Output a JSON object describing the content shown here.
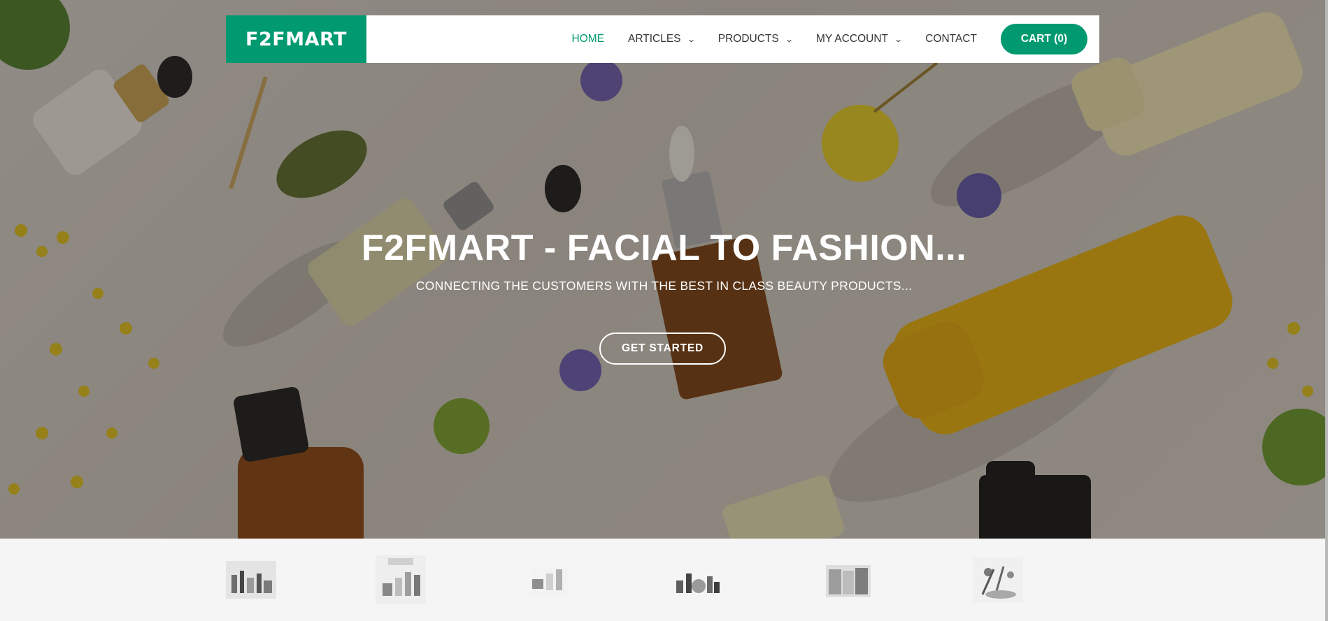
{
  "brand": {
    "logo_text": "F2FMART",
    "accent_color": "#009970"
  },
  "nav": {
    "items": [
      {
        "label": "HOME",
        "active": true,
        "has_dropdown": false
      },
      {
        "label": "ARTICLES",
        "active": false,
        "has_dropdown": true
      },
      {
        "label": "PRODUCTS",
        "active": false,
        "has_dropdown": true
      },
      {
        "label": "MY ACCOUNT",
        "active": false,
        "has_dropdown": true
      },
      {
        "label": "CONTACT",
        "active": false,
        "has_dropdown": false
      }
    ],
    "cart_label": "CART (0)",
    "dropdown_icon": "chevron-down-icon"
  },
  "hero": {
    "title": "F2FMART - FACIAL TO FASHION...",
    "subtitle": "CONNECTING THE CUSTOMERS WITH THE BEST IN CLASS BEAUTY PRODUCTS...",
    "cta_label": "GET STARTED",
    "background_image": "beauty-products-flatlay-image"
  },
  "product_thumbnails": [
    {
      "icon": "cosmetics-set-image"
    },
    {
      "icon": "skincare-bottles-image"
    },
    {
      "icon": "cream-jars-image"
    },
    {
      "icon": "makeup-items-image"
    },
    {
      "icon": "product-boxes-image"
    },
    {
      "icon": "beauty-tools-image"
    }
  ]
}
